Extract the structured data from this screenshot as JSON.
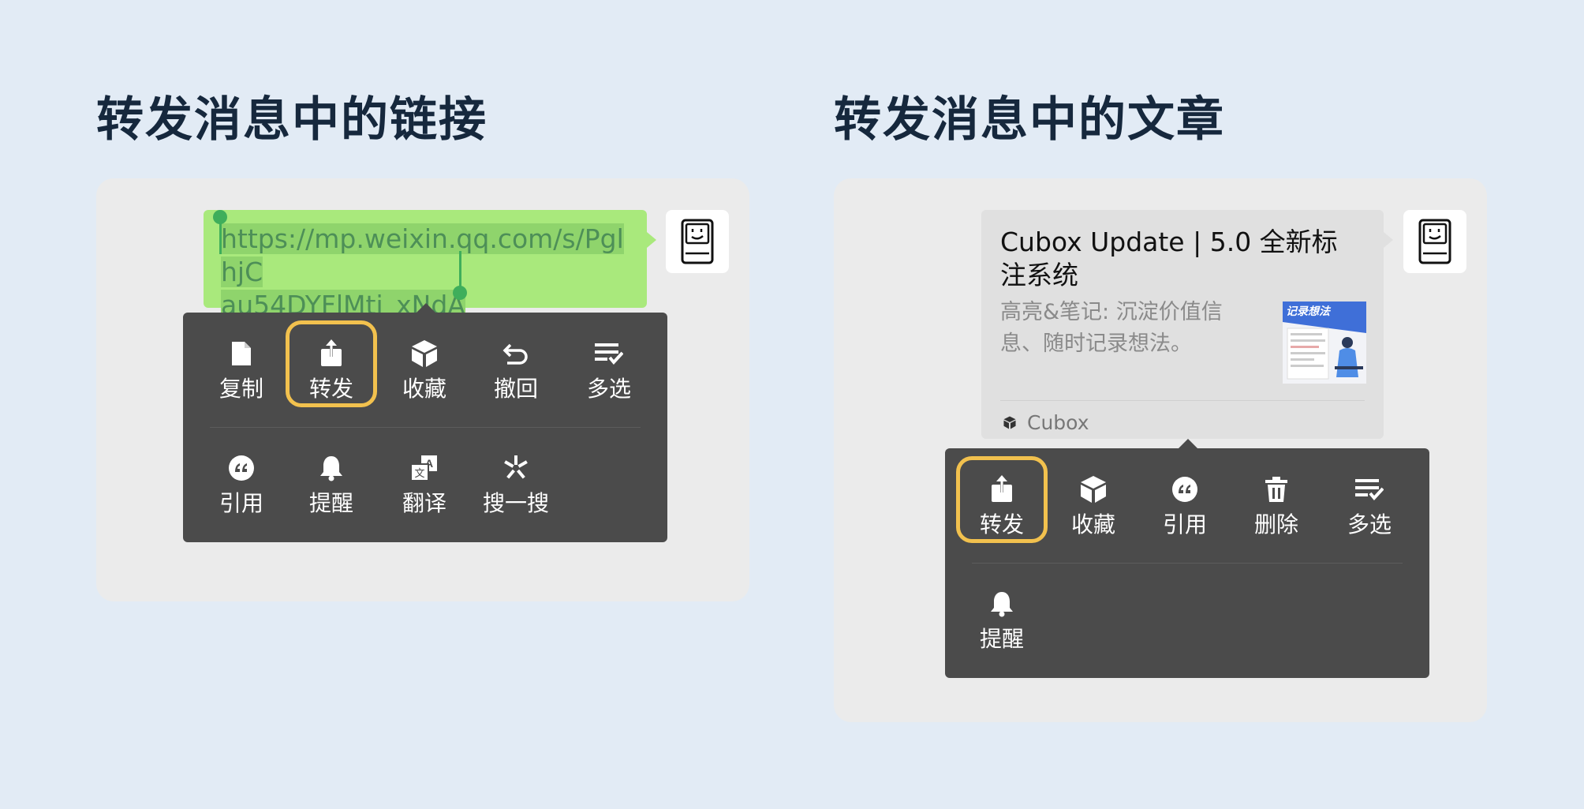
{
  "left": {
    "heading": "转发消息中的链接",
    "link_line1": "https://mp.weixin.qq.com/s/PglhjC",
    "link_line2": "au54DYFlMti_xNdA",
    "menu": {
      "row1": [
        {
          "label": "复制",
          "icon": "file-icon"
        },
        {
          "label": "转发",
          "icon": "share-icon"
        },
        {
          "label": "收藏",
          "icon": "cube-icon"
        },
        {
          "label": "撤回",
          "icon": "undo-icon"
        },
        {
          "label": "多选",
          "icon": "multi-select-icon"
        }
      ],
      "row2": [
        {
          "label": "引用",
          "icon": "quote-icon"
        },
        {
          "label": "提醒",
          "icon": "bell-icon"
        },
        {
          "label": "翻译",
          "icon": "translate-icon"
        },
        {
          "label": "搜一搜",
          "icon": "sparkle-search-icon"
        }
      ],
      "selected": "转发"
    }
  },
  "right": {
    "heading": "转发消息中的文章",
    "article": {
      "title": "Cubox Update | 5.0 全新标注系统",
      "description": "高亮&笔记: 沉淀价值信息、随时记录想法。",
      "thumbnail_text": "记录想法",
      "source": "Cubox"
    },
    "menu": {
      "row1": [
        {
          "label": "转发",
          "icon": "share-icon"
        },
        {
          "label": "收藏",
          "icon": "cube-icon"
        },
        {
          "label": "引用",
          "icon": "quote-icon"
        },
        {
          "label": "删除",
          "icon": "trash-icon"
        },
        {
          "label": "多选",
          "icon": "multi-select-icon"
        }
      ],
      "row2": [
        {
          "label": "提醒",
          "icon": "bell-icon"
        }
      ],
      "selected": "转发"
    }
  },
  "colors": {
    "background": "#e2ebf5",
    "card": "#ebebeb",
    "bubble_green": "#a9e97c",
    "menu_dark": "#4b4b4b",
    "highlight_border": "#f2c14e"
  }
}
